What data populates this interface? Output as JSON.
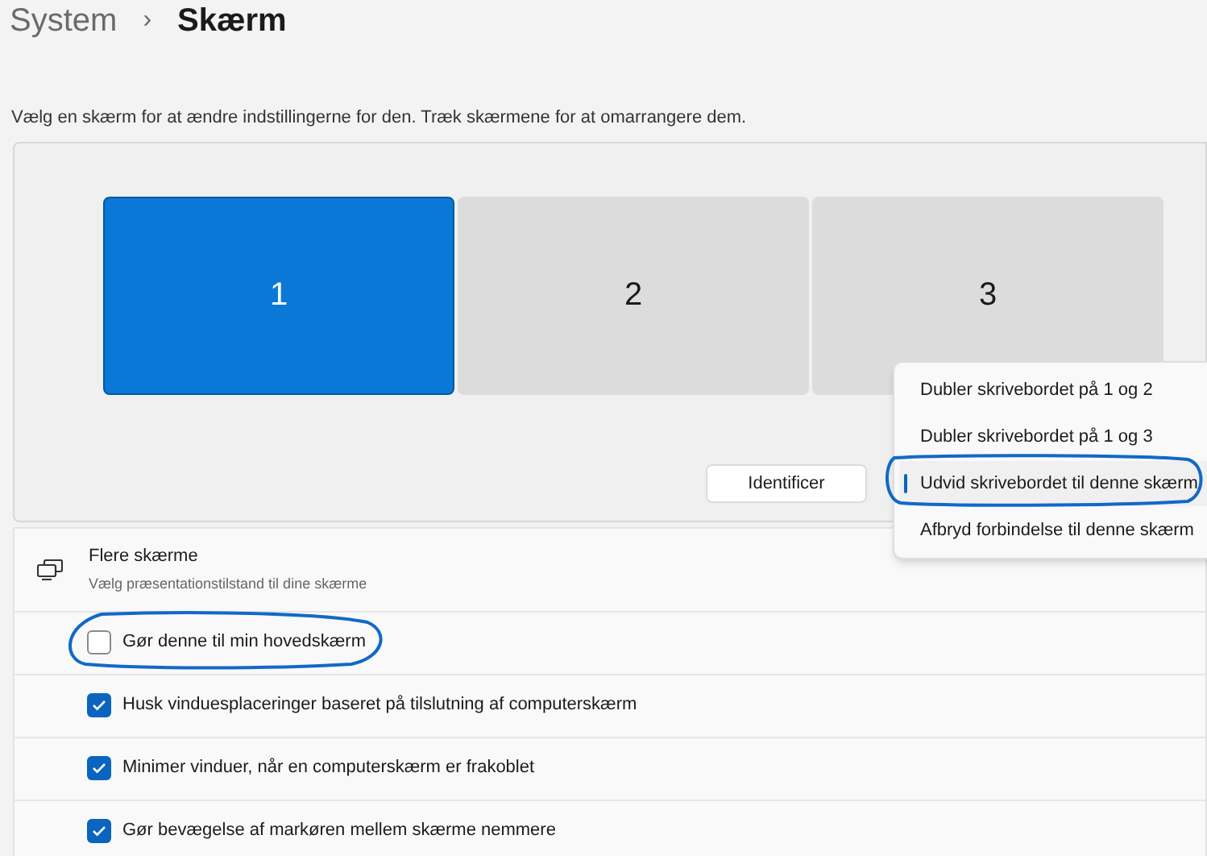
{
  "breadcrumb": {
    "parent": "System",
    "separator": "›",
    "current": "Skærm"
  },
  "description": "Vælg en skærm for at ændre indstillingerne for den. Træk skærmene for at omarrangere dem.",
  "monitors": [
    {
      "label": "1",
      "selected": true
    },
    {
      "label": "2",
      "selected": false
    },
    {
      "label": "3",
      "selected": false
    }
  ],
  "identify_button": "Identificer",
  "context_menu": [
    {
      "label": "Dubler skrivebordet på 1 og 2",
      "selected": false
    },
    {
      "label": "Dubler skrivebordet på 1 og 3",
      "selected": false
    },
    {
      "label": "Udvid skrivebordet til denne skærm",
      "selected": true
    },
    {
      "label": "Afbryd forbindelse til denne skærm",
      "selected": false
    }
  ],
  "multiple_displays": {
    "title": "Flere skærme",
    "subtitle": "Vælg præsentationstilstand til dine skærme"
  },
  "options": [
    {
      "label": "Gør denne til min hovedskærm",
      "checked": false
    },
    {
      "label": "Husk vinduesplaceringer baseret på tilslutning af computerskærm",
      "checked": true
    },
    {
      "label": "Minimer vinduer, når en computerskærm er frakoblet",
      "checked": true
    },
    {
      "label": "Gør bevægelse af markøren mellem skærme nemmere",
      "checked": true
    }
  ]
}
